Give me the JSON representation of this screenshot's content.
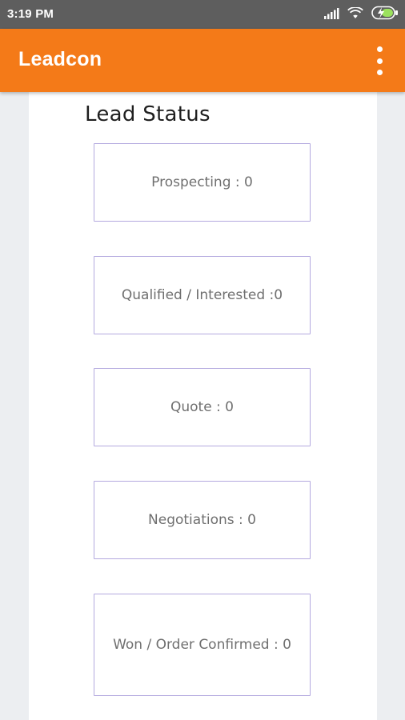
{
  "status_bar": {
    "time": "3:19 PM",
    "icons": [
      "signal-icon",
      "wifi-icon",
      "battery-charging-icon"
    ]
  },
  "app_bar": {
    "title": "Leadcon",
    "menu_icon": "more-vertical-icon",
    "background_color": "#f47a18"
  },
  "main": {
    "section_title": "Lead Status",
    "status_items": [
      {
        "label": "Prospecting : 0"
      },
      {
        "label": "Qualified / Interested :0"
      },
      {
        "label": "Quote : 0"
      },
      {
        "label": "Negotiations : 0"
      },
      {
        "label": "Won / Order Confirmed : 0"
      }
    ],
    "box_border_color": "#b3a9df"
  }
}
